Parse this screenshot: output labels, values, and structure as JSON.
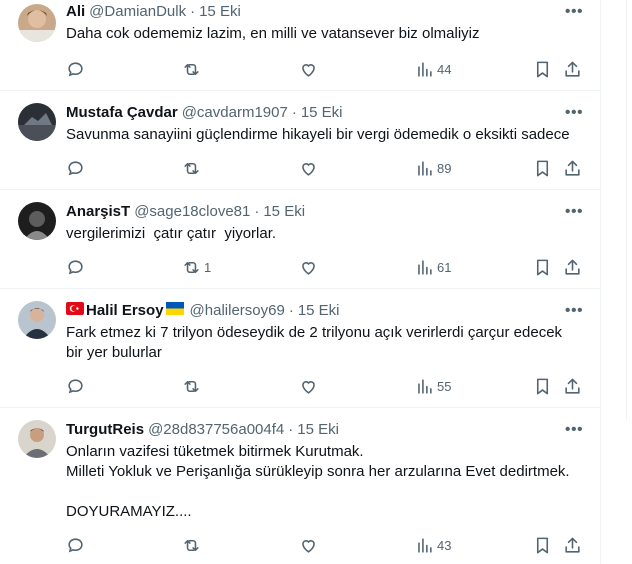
{
  "tweets": [
    {
      "name": "Ali",
      "handle": "@DamianDulk",
      "dot": "·",
      "date": "15 Eki",
      "flag_before": "",
      "flag_after": "",
      "text": "Daha cok odememiz lazim, en milli ve vatansever biz olmaliyiz",
      "retweets": "",
      "views": "44"
    },
    {
      "name": "Mustafa Çavdar",
      "handle": "@cavdarm1907",
      "dot": "·",
      "date": "15 Eki",
      "text": "Savunma sanayiini güçlendirme hikayeli bir vergi ödemedik o eksikti sadece",
      "retweets": "",
      "views": "89"
    },
    {
      "name": "AnarşisT",
      "handle": "@sage18clove81",
      "dot": "·",
      "date": "15 Eki",
      "text": "vergilerimizi  çatır çatır  yiyorlar.",
      "retweets": "1",
      "views": "61"
    },
    {
      "name": "Halil Ersoy",
      "handle": "@halilersoy69",
      "dot": "·",
      "date": "15 Eki",
      "flag_before": "turkey-flag",
      "flag_after": "ukraine-flag",
      "text": "Fark etmez ki 7 trilyon ödeseydik de 2 trilyonu açık verirlerdi çarçur edecek bir yer bulurlar",
      "retweets": "",
      "views": "55"
    },
    {
      "name": "TurgutReis",
      "handle": "@28d837756a004f4",
      "dot": "·",
      "date": "15 Eki",
      "text": "Onların vazifesi tüketmek bitirmek Kurutmak.\nMilleti Yokluk ve Perişanlığa sürükleyip sonra her arzularına Evet dedirtmek.\n\nDOYURAMAYIZ....",
      "retweets": "",
      "views": "43"
    }
  ],
  "colors": {
    "text": "#0f1419",
    "muted": "#536471",
    "border": "#eff3f4"
  },
  "icons": [
    "reply-icon",
    "retweet-icon",
    "like-icon",
    "views-icon",
    "bookmark-icon",
    "share-icon",
    "more-icon"
  ]
}
